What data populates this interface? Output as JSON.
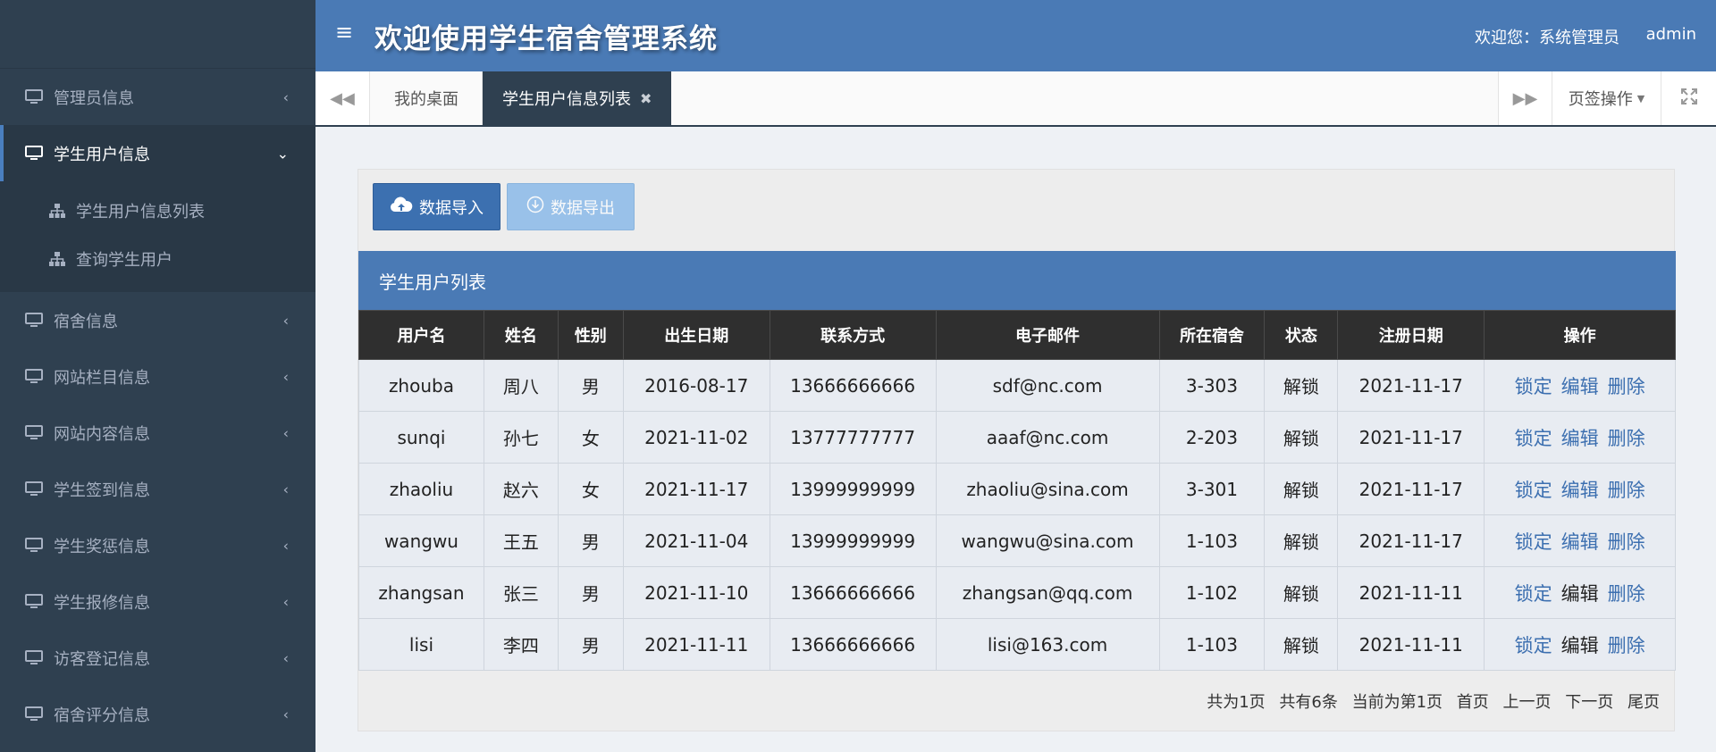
{
  "header": {
    "title": "欢迎使用学生宿舍管理系统",
    "welcome": "欢迎您：系统管理员",
    "user": "admin"
  },
  "sidebar": {
    "items": [
      {
        "label": "管理员信息",
        "active": false
      },
      {
        "label": "学生用户信息",
        "active": true,
        "sub": [
          "学生用户信息列表",
          "查询学生用户"
        ]
      },
      {
        "label": "宿舍信息",
        "active": false
      },
      {
        "label": "网站栏目信息",
        "active": false
      },
      {
        "label": "网站内容信息",
        "active": false
      },
      {
        "label": "学生签到信息",
        "active": false
      },
      {
        "label": "学生奖惩信息",
        "active": false
      },
      {
        "label": "学生报修信息",
        "active": false
      },
      {
        "label": "访客登记信息",
        "active": false
      },
      {
        "label": "宿舍评分信息",
        "active": false
      }
    ]
  },
  "tabs": {
    "desk": "我的桌面",
    "active": "学生用户信息列表",
    "ops": "页签操作"
  },
  "toolbar": {
    "import_label": "数据导入",
    "export_label": "数据导出"
  },
  "panel": {
    "title": "学生用户列表"
  },
  "table": {
    "headers": [
      "用户名",
      "姓名",
      "性别",
      "出生日期",
      "联系方式",
      "电子邮件",
      "所在宿舍",
      "状态",
      "注册日期",
      "操作"
    ],
    "rows": [
      [
        "zhouba",
        "周八",
        "男",
        "2016-08-17",
        "13666666666",
        "sdf@nc.com",
        "3-303",
        "解锁",
        "2021-11-17"
      ],
      [
        "sunqi",
        "孙七",
        "女",
        "2021-11-02",
        "13777777777",
        "aaaf@nc.com",
        "2-203",
        "解锁",
        "2021-11-17"
      ],
      [
        "zhaoliu",
        "赵六",
        "女",
        "2021-11-17",
        "13999999999",
        "zhaoliu@sina.com",
        "3-301",
        "解锁",
        "2021-11-17"
      ],
      [
        "wangwu",
        "王五",
        "男",
        "2021-11-04",
        "13999999999",
        "wangwu@sina.com",
        "1-103",
        "解锁",
        "2021-11-17"
      ],
      [
        "zhangsan",
        "张三",
        "男",
        "2021-11-10",
        "13666666666",
        "zhangsan@qq.com",
        "1-102",
        "解锁",
        "2021-11-11"
      ],
      [
        "lisi",
        "李四",
        "男",
        "2021-11-11",
        "13666666666",
        "lisi@163.com",
        "1-103",
        "解锁",
        "2021-11-11"
      ]
    ],
    "actions": [
      "锁定",
      "编辑",
      "删除"
    ]
  },
  "pager": {
    "total_pages": "共为1页",
    "total_items": "共有6条",
    "current": "当前为第1页",
    "first": "首页",
    "prev": "上一页",
    "next": "下一页",
    "last": "尾页"
  },
  "colors": {
    "sidebar_bg": "#2f4050",
    "header_bg": "#4a7ab5",
    "link": "#3c6fb0"
  }
}
